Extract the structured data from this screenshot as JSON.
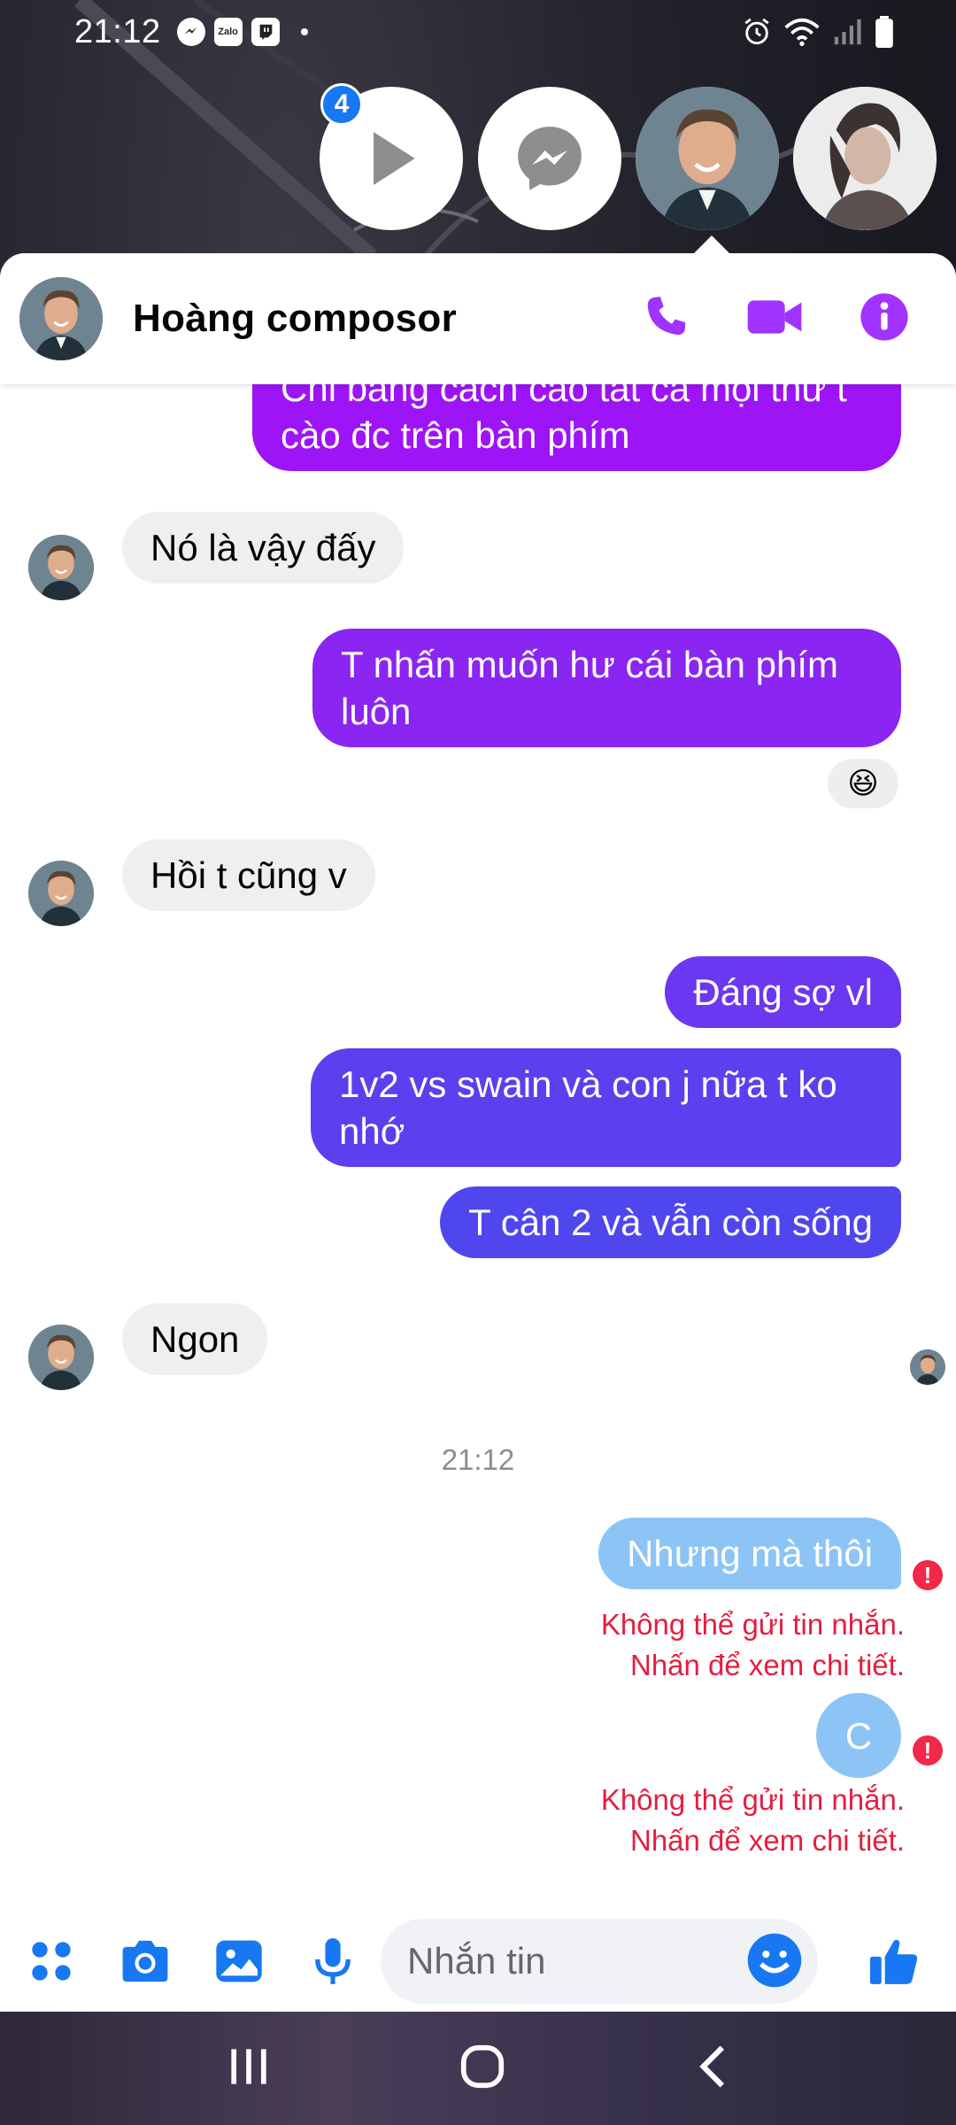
{
  "status_bar": {
    "time": "21:12",
    "apps": [
      "messenger-icon",
      "zalo-icon",
      "twitch-icon"
    ],
    "zalo_label": "Zalo"
  },
  "chat_heads": {
    "badge_count": "4",
    "items": [
      "video-play-icon",
      "messenger-icon",
      "contact-avatar",
      "artist-avatar"
    ]
  },
  "header": {
    "contact_name": "Hoàng composor"
  },
  "messages": [
    {
      "side": "out",
      "text": "Chỉ bằng cách cào tất cả mọi thứ t cào đc trên bàn phím",
      "color": "#9d14f6"
    },
    {
      "side": "in",
      "text": "Nó là vậy đấy"
    },
    {
      "side": "out",
      "text": "T nhấn muốn hư cái bàn phím luôn",
      "color": "#8a25f2",
      "reaction": "😆"
    },
    {
      "side": "in",
      "text": "Hồi t cũng v"
    },
    {
      "side": "out",
      "text": "Đáng sợ vl",
      "color": "#6b37f0"
    },
    {
      "side": "out",
      "text": "1v2 vs swain và con j nữa t ko nhớ",
      "color": "#5b40ef"
    },
    {
      "side": "out",
      "text": "T cân 2 và vẫn còn sống",
      "color": "#4f46ee"
    },
    {
      "side": "in",
      "text": "Ngon"
    }
  ],
  "timestamp": "21:12",
  "failed_messages": [
    {
      "text": "Nhưng mà thôi",
      "error_line1": "Không thể gửi tin nhắn.",
      "error_line2": "Nhấn để xem chi tiết."
    },
    {
      "text": "C",
      "error_line1": "Không thể gửi tin nhắn.",
      "error_line2": "Nhấn để xem chi tiết."
    }
  ],
  "composer": {
    "placeholder": "Nhắn tin"
  },
  "colors": {
    "accent": "#a033ff",
    "failed_bubble": "#8dc4f6",
    "error": "#e41e3f",
    "composer_icon": "#1877f2"
  }
}
